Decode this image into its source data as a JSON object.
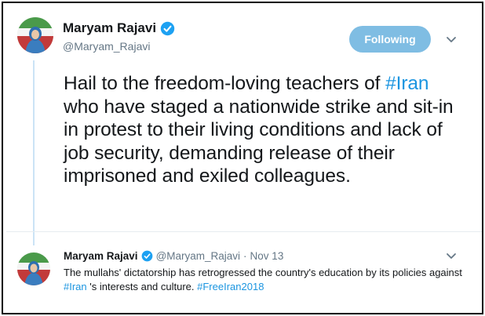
{
  "colors": {
    "link": "#1b95e0",
    "follow_button": "#7fbde3",
    "verified": "#1da1f2",
    "muted": "#657786"
  },
  "tweet": {
    "author_name": "Maryam Rajavi",
    "author_handle": "@Maryam_Rajavi",
    "follow_label": "Following",
    "text_part1": "Hail to the freedom-loving teachers of ",
    "hashtag": "#Iran",
    "text_part2": " who have staged a nationwide strike and sit-in in protest to their living conditions and lack of job security, demanding release of their imprisoned and exiled colleagues."
  },
  "reply": {
    "author_name": "Maryam Rajavi",
    "author_handle": "@Maryam_Rajavi",
    "separator": "·",
    "date": "Nov 13",
    "text_part1": "The mullahs' dictatorship has retrogressed the country's education by its policies against ",
    "hashtag1": "#Iran",
    "text_part2": " 's interests and culture. ",
    "hashtag2": "#FreeIran2018"
  },
  "icons": {
    "verified": "verified-badge-icon",
    "caret": "chevron-down-icon"
  }
}
